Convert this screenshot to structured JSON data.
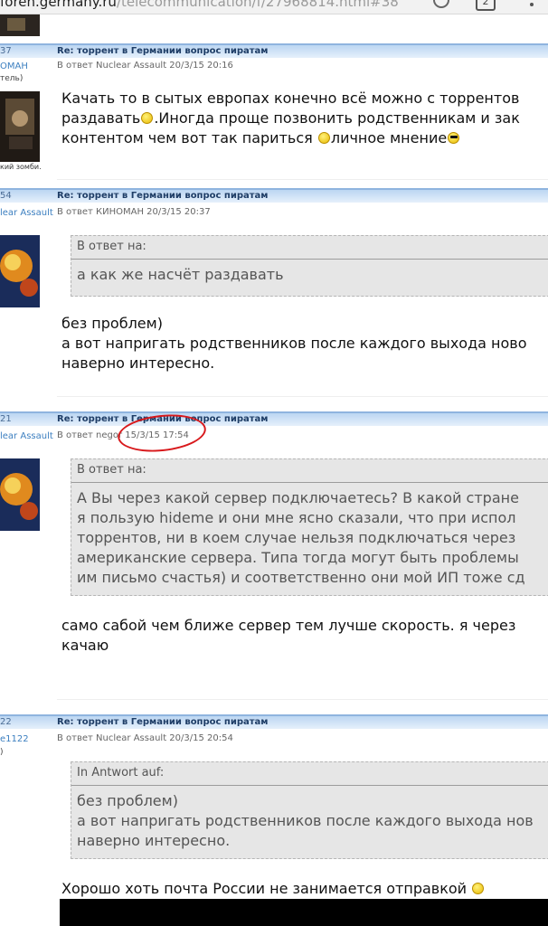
{
  "browser": {
    "url_host": "foren.germany.ru",
    "url_path": "/telecommunication/f/27968814.html#38",
    "tab_count": "2"
  },
  "posts": [
    {
      "num": "37",
      "title": "Re: торрент в Германии вопрос пиратам",
      "author": "ОМАН",
      "author_sub": "тель)",
      "reply_meta": "В ответ Nuclear Assault 20/3/15 20:16",
      "avatar_caption": "кий зомби.",
      "body": [
        {
          "text": "Качать то в сытых европах конечно всё можно с торрентов",
          "smiley": ""
        },
        {
          "text": "раздавать",
          "smiley": "smile",
          "after": ".Иногда проще позвонить родственникам и зак"
        },
        {
          "text": "контентом чем вот так париться ",
          "smiley": "smile",
          "after": "личное мнение",
          "smiley2": "cool"
        }
      ]
    },
    {
      "num": "54",
      "title": "Re: торрент в Германии вопрос пиратам",
      "author": "lear Assault",
      "reply_meta": "В ответ КИНОМАН 20/3/15 20:37",
      "quote_head": "В ответ на:",
      "quote_lines": [
        "а как же насчёт раздавать"
      ],
      "body": [
        "без проблем)",
        "а вот напригать родственников после каждого выхода ново",
        "наверно интересно."
      ]
    },
    {
      "num": "21",
      "title": "Re: торрент в Германии вопрос пиратам",
      "author": "lear Assault",
      "reply_meta": "В ответ negor 15/3/15 17:54",
      "quote_head": "В ответ на:",
      "quote_lines": [
        "А Вы через какой сервер подключаетесь? В какой стране",
        "я пользую hideme и они мне ясно сказали, что при испол",
        "торрентов, ни в коем случае нельзя подключаться через",
        "американские сервера. Типа тогда могут быть проблемы",
        "им письмо счастья) и соответственно они мой ИП тоже сд"
      ],
      "body": [
        "само сабой чем ближе сервер тем лучше скорость. я через",
        "качаю"
      ]
    },
    {
      "num": "22",
      "title": "Re: торрент в Германии вопрос пиратам",
      "author": "e1122",
      "author_sub": ")",
      "reply_meta": "В ответ Nuclear Assault 20/3/15 20:54",
      "quote_head": "In Antwort auf:",
      "quote_lines": [
        "без проблем)",
        "а вот напригать родственников после каждого выхода нов",
        "наверно интересно."
      ],
      "body": [
        "Хорошо хоть почта России не занимается отправкой"
      ]
    }
  ],
  "colors": {
    "header": "#bcd6f2",
    "accent": "#3c7fc0",
    "annotation": "#d8191c"
  }
}
